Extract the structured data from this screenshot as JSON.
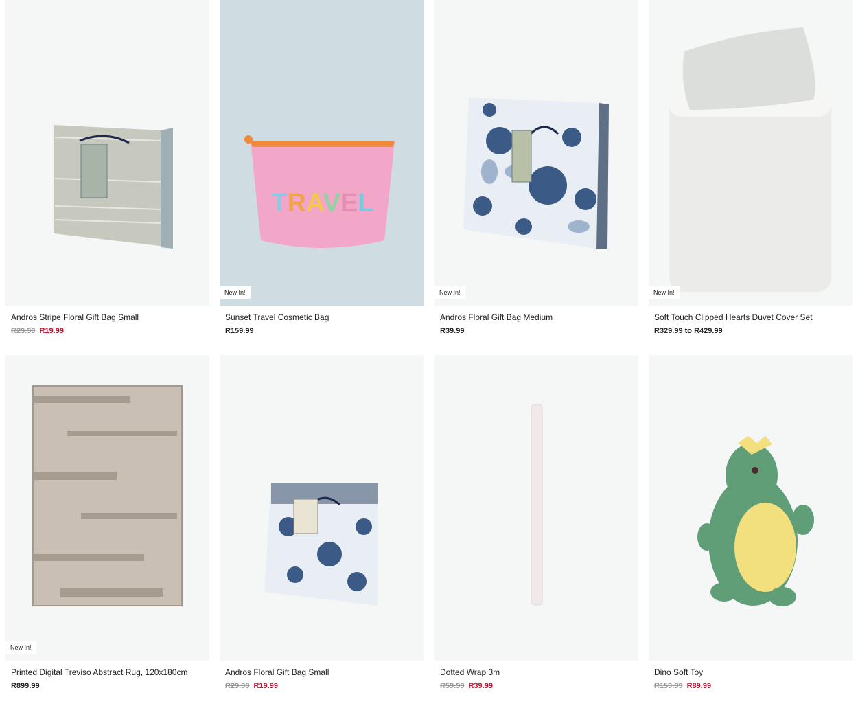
{
  "products": [
    {
      "name": "Andros Stripe Floral Gift Bag Small",
      "was": "R29.99",
      "now": "R19.99",
      "price": "",
      "badge": ""
    },
    {
      "name": "Sunset Travel Cosmetic Bag",
      "was": "",
      "now": "",
      "price": "R159.99",
      "badge": "New In!",
      "print_text": "TRAVEL"
    },
    {
      "name": "Andros Floral Gift Bag Medium",
      "was": "",
      "now": "",
      "price": "R39.99",
      "badge": "New In!"
    },
    {
      "name": "Soft Touch Clipped Hearts Duvet Cover Set",
      "was": "",
      "now": "",
      "price": "R329.99 to R429.99",
      "badge": "New In!"
    },
    {
      "name": "Printed Digital Treviso Abstract Rug, 120x180cm",
      "was": "",
      "now": "",
      "price": "R899.99",
      "badge": "New In!"
    },
    {
      "name": "Andros Floral Gift Bag Small",
      "was": "R29.99",
      "now": "R19.99",
      "price": "",
      "badge": ""
    },
    {
      "name": "Dotted Wrap 3m",
      "was": "R59.99",
      "now": "R39.99",
      "price": "",
      "badge": ""
    },
    {
      "name": "Dino Soft Toy",
      "was": "R159.99",
      "now": "R89.99",
      "price": "",
      "badge": ""
    }
  ],
  "colors": {
    "sale": "#c8102e",
    "strike": "#9a9a9a",
    "tile_bg": "#f5f6f6",
    "travel_bg": "#cfdde2"
  }
}
